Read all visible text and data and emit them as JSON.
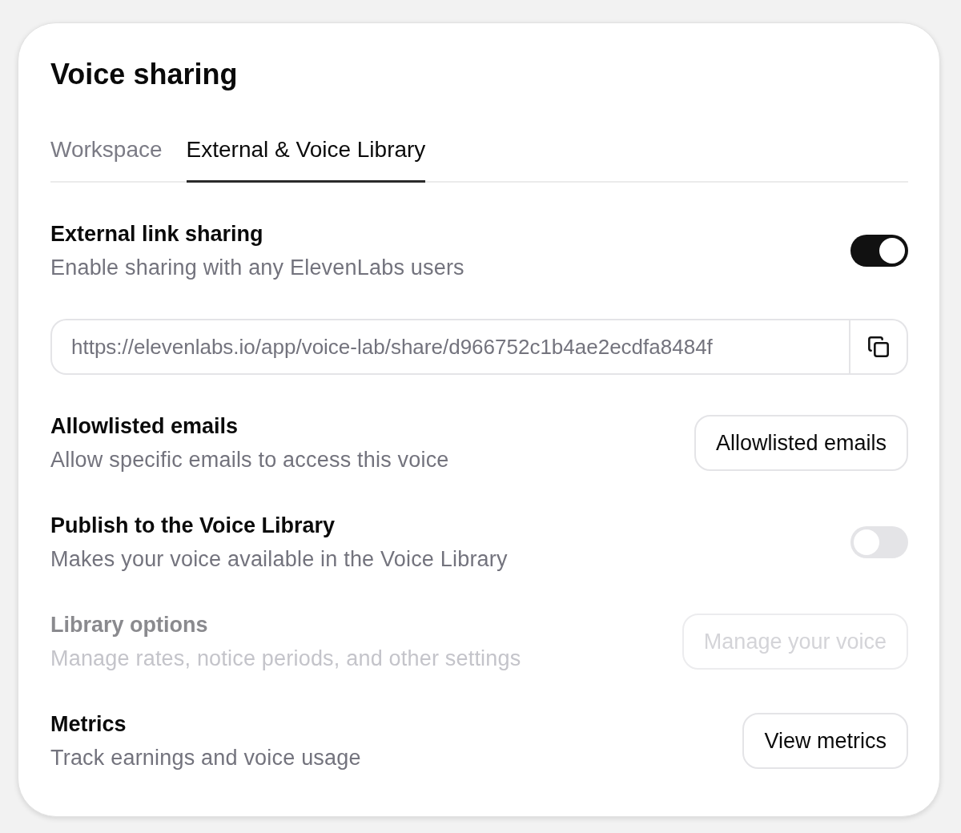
{
  "dialog": {
    "title": "Voice sharing"
  },
  "tabs": [
    {
      "label": "Workspace",
      "selected": false
    },
    {
      "label": "External & Voice Library",
      "selected": true
    }
  ],
  "settings": [
    {
      "kind": "toggle",
      "title": "External link sharing",
      "description": "Enable sharing with any ElevenLabs users",
      "on": true,
      "disabled": false
    },
    {
      "kind": "link",
      "value": "https://elevenlabs.io/app/voice-lab/share/d966752c1b4ae2ecdfa8484f",
      "disabled": false
    },
    {
      "kind": "button",
      "title": "Allowlisted emails",
      "description": "Allow specific emails to access this voice",
      "button": "Allowlisted emails",
      "disabled": false
    },
    {
      "kind": "toggle",
      "title": "Publish to the Voice Library",
      "description": "Makes your voice available in the Voice Library",
      "on": false,
      "disabled": false
    },
    {
      "kind": "button",
      "title": "Library options",
      "description": "Manage rates, notice periods, and other settings",
      "button": "Manage your voice",
      "disabled": true
    },
    {
      "kind": "button",
      "title": "Metrics",
      "description": "Track earnings and voice usage",
      "button": "View metrics",
      "disabled": false
    }
  ]
}
